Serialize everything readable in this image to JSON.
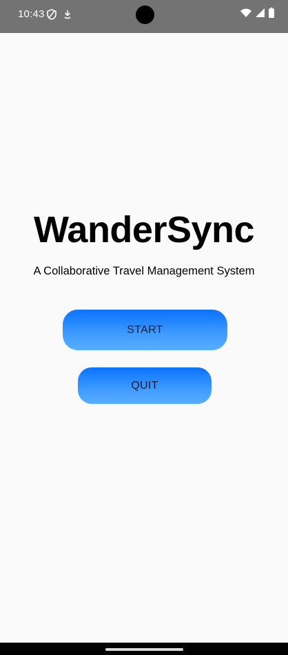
{
  "status_bar": {
    "time": "10:43",
    "left_icons": [
      "shield-icon",
      "download-icon"
    ],
    "right_icons": [
      "wifi-icon",
      "signal-icon",
      "battery-icon"
    ]
  },
  "main": {
    "title": "WanderSync",
    "subtitle": "A Collaborative Travel Management System",
    "start_label": "START",
    "quit_label": "QUIT"
  },
  "colors": {
    "background": "#fafafa",
    "status_bar": "#737373",
    "button_gradient_top": "#0a73ff",
    "button_gradient_bottom": "#5aaeff",
    "nav_bar": "#000000"
  }
}
